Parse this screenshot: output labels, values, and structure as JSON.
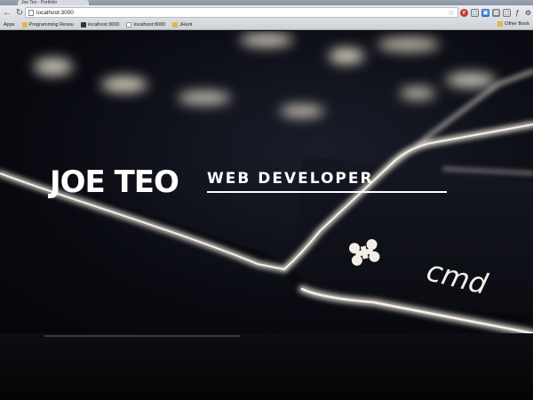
{
  "browser": {
    "tab_title": "Joe Teo - Portfolio",
    "url": "localhost:3000",
    "bookmarks": [
      "Apps",
      "Programming Resou",
      "localhost:3000",
      "localhost:8000",
      "JHunt"
    ],
    "other_bookmarks": "Other Book"
  },
  "hero": {
    "name": "JOE TEO",
    "title": "WEB DEVELOPER",
    "keyboard_label": "cmd"
  }
}
